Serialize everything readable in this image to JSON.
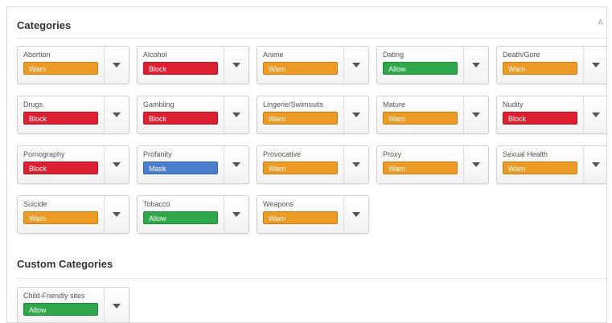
{
  "header": {
    "title": "Categories",
    "corner": "A"
  },
  "categories": [
    {
      "label": "Abortion",
      "status": "Warn",
      "kind": "warn"
    },
    {
      "label": "Alcohol",
      "status": "Block",
      "kind": "block"
    },
    {
      "label": "Anime",
      "status": "Warn",
      "kind": "warn"
    },
    {
      "label": "Dating",
      "status": "Allow",
      "kind": "allow"
    },
    {
      "label": "Death/Gore",
      "status": "Warn",
      "kind": "warn"
    },
    {
      "label": "Drugs",
      "status": "Block",
      "kind": "block"
    },
    {
      "label": "Gambling",
      "status": "Block",
      "kind": "block"
    },
    {
      "label": "Lingerie/Swimsuits",
      "status": "Warn",
      "kind": "warn"
    },
    {
      "label": "Mature",
      "status": "Warn",
      "kind": "warn"
    },
    {
      "label": "Nudity",
      "status": "Block",
      "kind": "block"
    },
    {
      "label": "Pornography",
      "status": "Block",
      "kind": "block"
    },
    {
      "label": "Profanity",
      "status": "Mask",
      "kind": "mask"
    },
    {
      "label": "Provocative",
      "status": "Warn",
      "kind": "warn"
    },
    {
      "label": "Proxy",
      "status": "Warn",
      "kind": "warn"
    },
    {
      "label": "Sexual Health",
      "status": "Warn",
      "kind": "warn"
    },
    {
      "label": "Suicide",
      "status": "Warn",
      "kind": "warn"
    },
    {
      "label": "Tobacco",
      "status": "Allow",
      "kind": "allow"
    },
    {
      "label": "Weapons",
      "status": "Warn",
      "kind": "warn"
    }
  ],
  "custom": {
    "title": "Custom Categories",
    "items": [
      {
        "label": "Child-Friendly sites",
        "status": "Allow",
        "kind": "allow"
      }
    ]
  }
}
